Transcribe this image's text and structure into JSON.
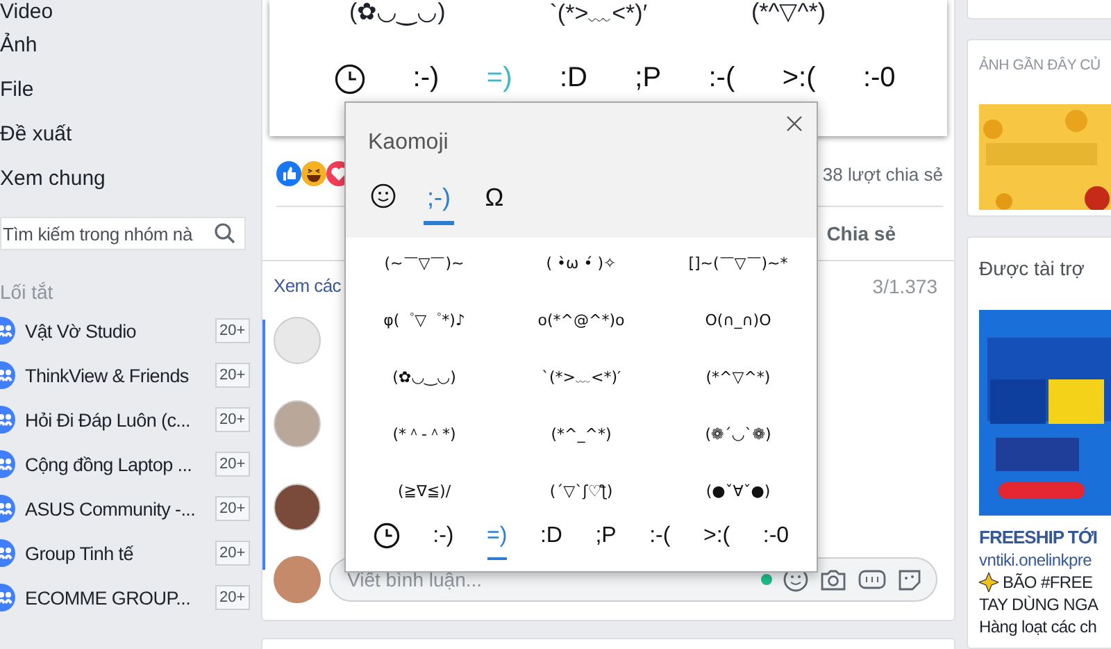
{
  "sidebar": {
    "nav": [
      "Video",
      "Ảnh",
      "File",
      "Đề xuất",
      "Xem chung"
    ],
    "search": {
      "placeholder": "Tìm kiếm trong nhóm nà"
    },
    "shortcuts_title": "Lối tắt",
    "groups": [
      {
        "name": "Vật Vờ Studio",
        "badge": "20+"
      },
      {
        "name": "ThinkView & Friends",
        "badge": "20+"
      },
      {
        "name": "Hỏi Đi Đáp Luôn (c...",
        "badge": "20+"
      },
      {
        "name": "Cộng đồng Laptop ...",
        "badge": "20+"
      },
      {
        "name": "ASUS Community -...",
        "badge": "20+"
      },
      {
        "name": "Group Tinh tế",
        "badge": "20+"
      },
      {
        "name": "ECOMME GROUP...",
        "badge": "20+"
      }
    ]
  },
  "post": {
    "image": {
      "kaomoji": [
        "(✿◡‿◡)",
        "`(*>﹏<*)′",
        "(*^▽^*)"
      ],
      "categories": [
        {
          "kind": "recent",
          "selected": false
        },
        {
          "kind": "text",
          "label": ":-)",
          "selected": false
        },
        {
          "kind": "text",
          "label": "=)",
          "selected": true
        },
        {
          "kind": "text",
          "label": ":D",
          "selected": false
        },
        {
          "kind": "text",
          "label": ";P",
          "selected": false
        },
        {
          "kind": "text",
          "label": ":-(",
          "selected": false
        },
        {
          "kind": "text",
          "label": ">:(",
          "selected": false
        },
        {
          "kind": "text",
          "label": ":-0",
          "selected": false
        }
      ]
    },
    "shares": "38 lượt chia sẻ",
    "share_button": "Chia sẻ",
    "comments": {
      "more_link": "Xem các",
      "count": "3/1.373",
      "input": {
        "placeholder": "Viết bình luận..."
      }
    }
  },
  "popup": {
    "title": "Kaomoji",
    "tabs": [
      {
        "kind": "smiley",
        "selected": false
      },
      {
        "kind": "text",
        "label": ";-)",
        "selected": true
      },
      {
        "kind": "text",
        "label": "Ω",
        "selected": false
      }
    ],
    "grid": [
      "(~￣▽￣)~",
      "( •̀ω •́ )✧",
      "[]~(￣▽￣)~*",
      "φ(゜▽゜*)♪",
      "o(*^@^*)o",
      "O(∩_∩)O",
      "(✿◡‿◡)",
      "`(*>﹏<*)′",
      "(*^▽^*)",
      "(*＾-＾*)",
      "(*^_^*)",
      "(❁´◡`❁)",
      "(≧∇≦)/",
      "(´▽`ʃ♡ƪ)",
      "(●ˇ∀ˇ●)"
    ],
    "categories": [
      {
        "kind": "recent",
        "selected": false
      },
      {
        "kind": "text",
        "label": ":-)",
        "selected": false
      },
      {
        "kind": "text",
        "label": "=)",
        "selected": true
      },
      {
        "kind": "text",
        "label": ":D",
        "selected": false
      },
      {
        "kind": "text",
        "label": ";P",
        "selected": false
      },
      {
        "kind": "text",
        "label": ":-(",
        "selected": false
      },
      {
        "kind": "text",
        "label": ">:(",
        "selected": false
      },
      {
        "kind": "text",
        "label": ":-0",
        "selected": false
      }
    ]
  },
  "right": {
    "recent_photos_title": "ẢNH GẦN ĐÂY CỦ",
    "sponsored_title": "Được tài trợ",
    "ad": {
      "title": "FREESHIP TỚI",
      "url": "vntiki.onelinkpre",
      "lines": [
        "BÃO #FREE",
        "TAY DÙNG NGA",
        "Hàng loạt các ch"
      ]
    }
  }
}
